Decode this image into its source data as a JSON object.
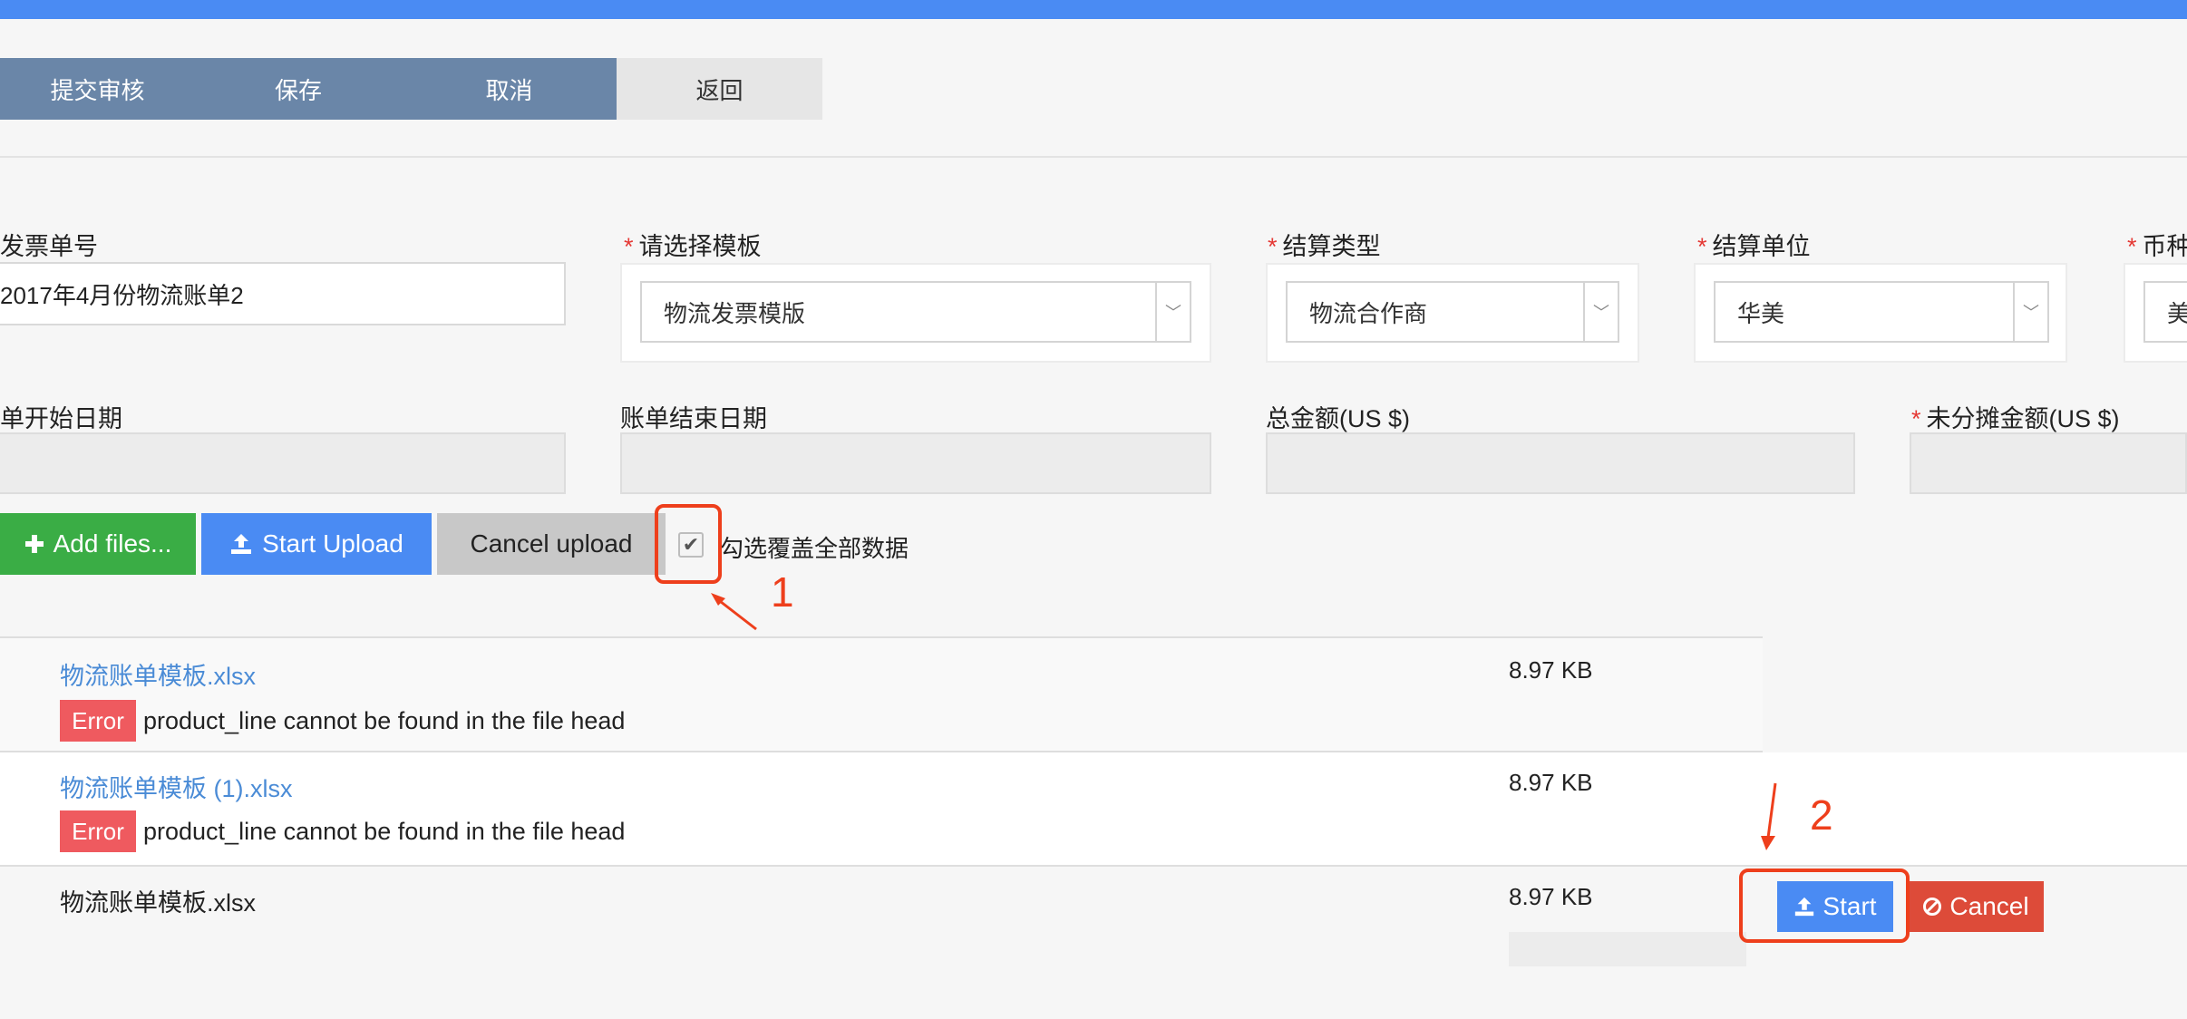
{
  "toolbar": {
    "submit_label": "提交审核",
    "save_label": "保存",
    "cancel_label": "取消",
    "back_label": "返回"
  },
  "form": {
    "invoice_no": {
      "label": "发票单号",
      "value": "2017年4月份物流账单2"
    },
    "template": {
      "label": "请选择模板",
      "value": "物流发票模版"
    },
    "settle_type": {
      "label": "结算类型",
      "value": "物流合作商"
    },
    "settle_unit": {
      "label": "结算单位",
      "value": "华美"
    },
    "currency": {
      "label": "币种",
      "value": "美"
    },
    "start_date": {
      "label": "单开始日期"
    },
    "end_date": {
      "label": "账单结束日期"
    },
    "total": {
      "label": "总金额(US $)"
    },
    "unallocated": {
      "label": "未分摊金额(US $)"
    },
    "required_mark": "*"
  },
  "upload": {
    "add_label": "Add files...",
    "start_label": "Start Upload",
    "cancel_label": "Cancel upload",
    "overwrite_label": "勾选覆盖全部数据",
    "overwrite_checked": true
  },
  "annotations": {
    "one": "1",
    "two": "2"
  },
  "files": [
    {
      "name": "物流账单模板.xlsx",
      "size": "8.97 KB",
      "status": "Error",
      "message": "product_line cannot be found in the file head"
    },
    {
      "name": "物流账单模板 (1).xlsx",
      "size": "8.97 KB",
      "status": "Error",
      "message": "product_line cannot be found in the file head"
    },
    {
      "name": "物流账单模板.xlsx",
      "size": "8.97 KB",
      "start_label": "Start",
      "cancel_label": "Cancel"
    }
  ],
  "colors": {
    "topbar": "#4a8bf3",
    "toolbar": "#6a86a8",
    "green": "#3aad45",
    "blue": "#4a8bf3",
    "error": "#ef5a5f",
    "cancel_red": "#dd4b39",
    "annotation": "#ee3f1c"
  }
}
